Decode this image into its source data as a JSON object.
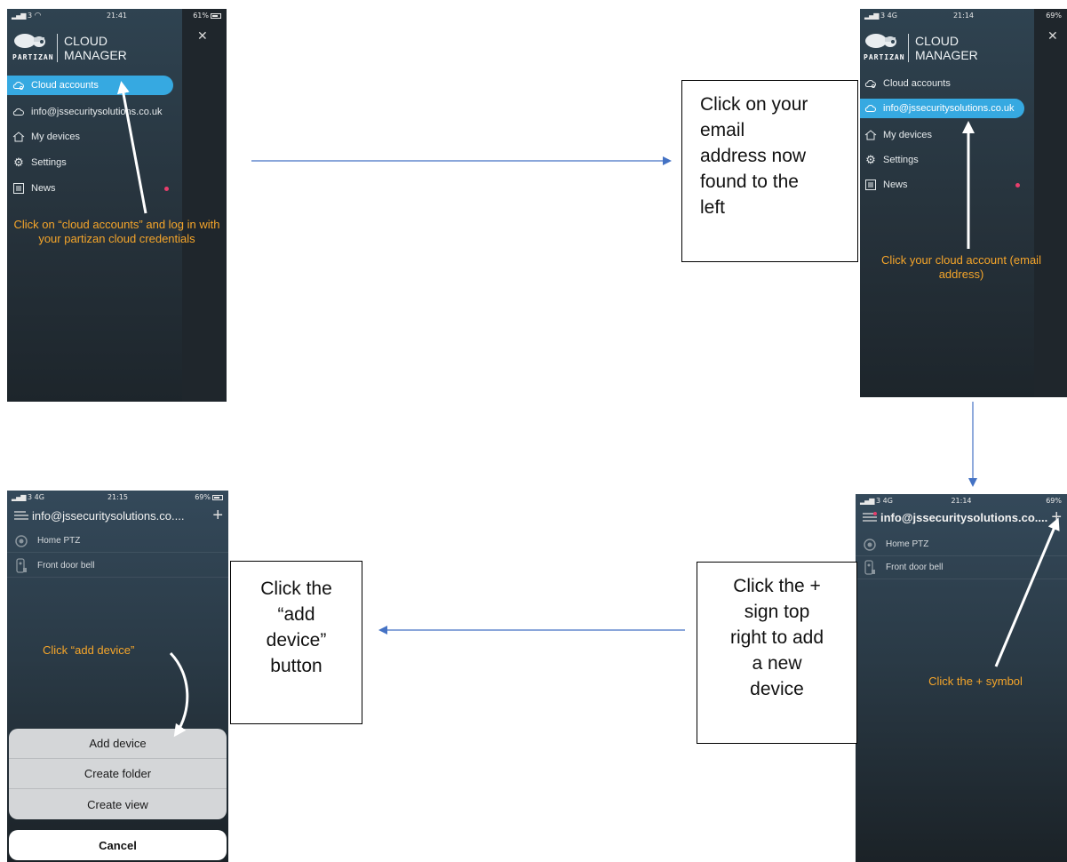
{
  "panel1": {
    "status": {
      "signal": "3",
      "time": "21:41",
      "battery": "61%"
    },
    "brand": {
      "logo_word": "PARTIZAN",
      "line1": "CLOUD",
      "line2": "MANAGER"
    },
    "menu": [
      "Cloud accounts",
      "info@jssecuritysolutions.co.uk",
      "My devices",
      "Settings",
      "News"
    ],
    "icons": [
      "cloud-gear-icon",
      "cloud-icon",
      "home-icon",
      "gear-icon",
      "news-icon"
    ],
    "note": "Click on “cloud accounts” and log in with your partizan cloud credentials"
  },
  "panel2": {
    "status": {
      "signal": "3  4G",
      "time": "21:14",
      "battery": "69%"
    },
    "brand": {
      "logo_word": "PARTIZAN",
      "line1": "CLOUD",
      "line2": "MANAGER"
    },
    "menu": [
      "Cloud accounts",
      "info@jssecuritysolutions.co.uk",
      "My devices",
      "Settings",
      "News"
    ],
    "note": "Click your cloud account (email address)"
  },
  "panel3": {
    "status": {
      "signal": "3  4G",
      "time": "21:15",
      "battery": "69%"
    },
    "title": "info@jssecuritysolutions.co....",
    "devices": [
      "Home PTZ",
      "Front door bell"
    ],
    "note": "Click “add device”",
    "sheet": [
      "Add device",
      "Create folder",
      "Create view"
    ],
    "cancel": "Cancel"
  },
  "panel4": {
    "status": {
      "signal": "3  4G",
      "time": "21:14",
      "battery": "69%"
    },
    "title": "info@jssecuritysolutions.co....",
    "devices": [
      "Home PTZ",
      "Front door bell"
    ],
    "note": "Click the + symbol"
  },
  "callouts": {
    "email": [
      "Click on your",
      "email",
      "address now",
      "found to the",
      "left"
    ],
    "plus": [
      "Click the +",
      "sign top",
      "right to add",
      "a new",
      "device"
    ],
    "add": [
      "Click the",
      "“add",
      "device”",
      "button"
    ]
  },
  "colors": {
    "accent": "#36a9e1",
    "note": "#f5a52a",
    "arrow": "#4472c4",
    "badge": "#e83e6c"
  }
}
